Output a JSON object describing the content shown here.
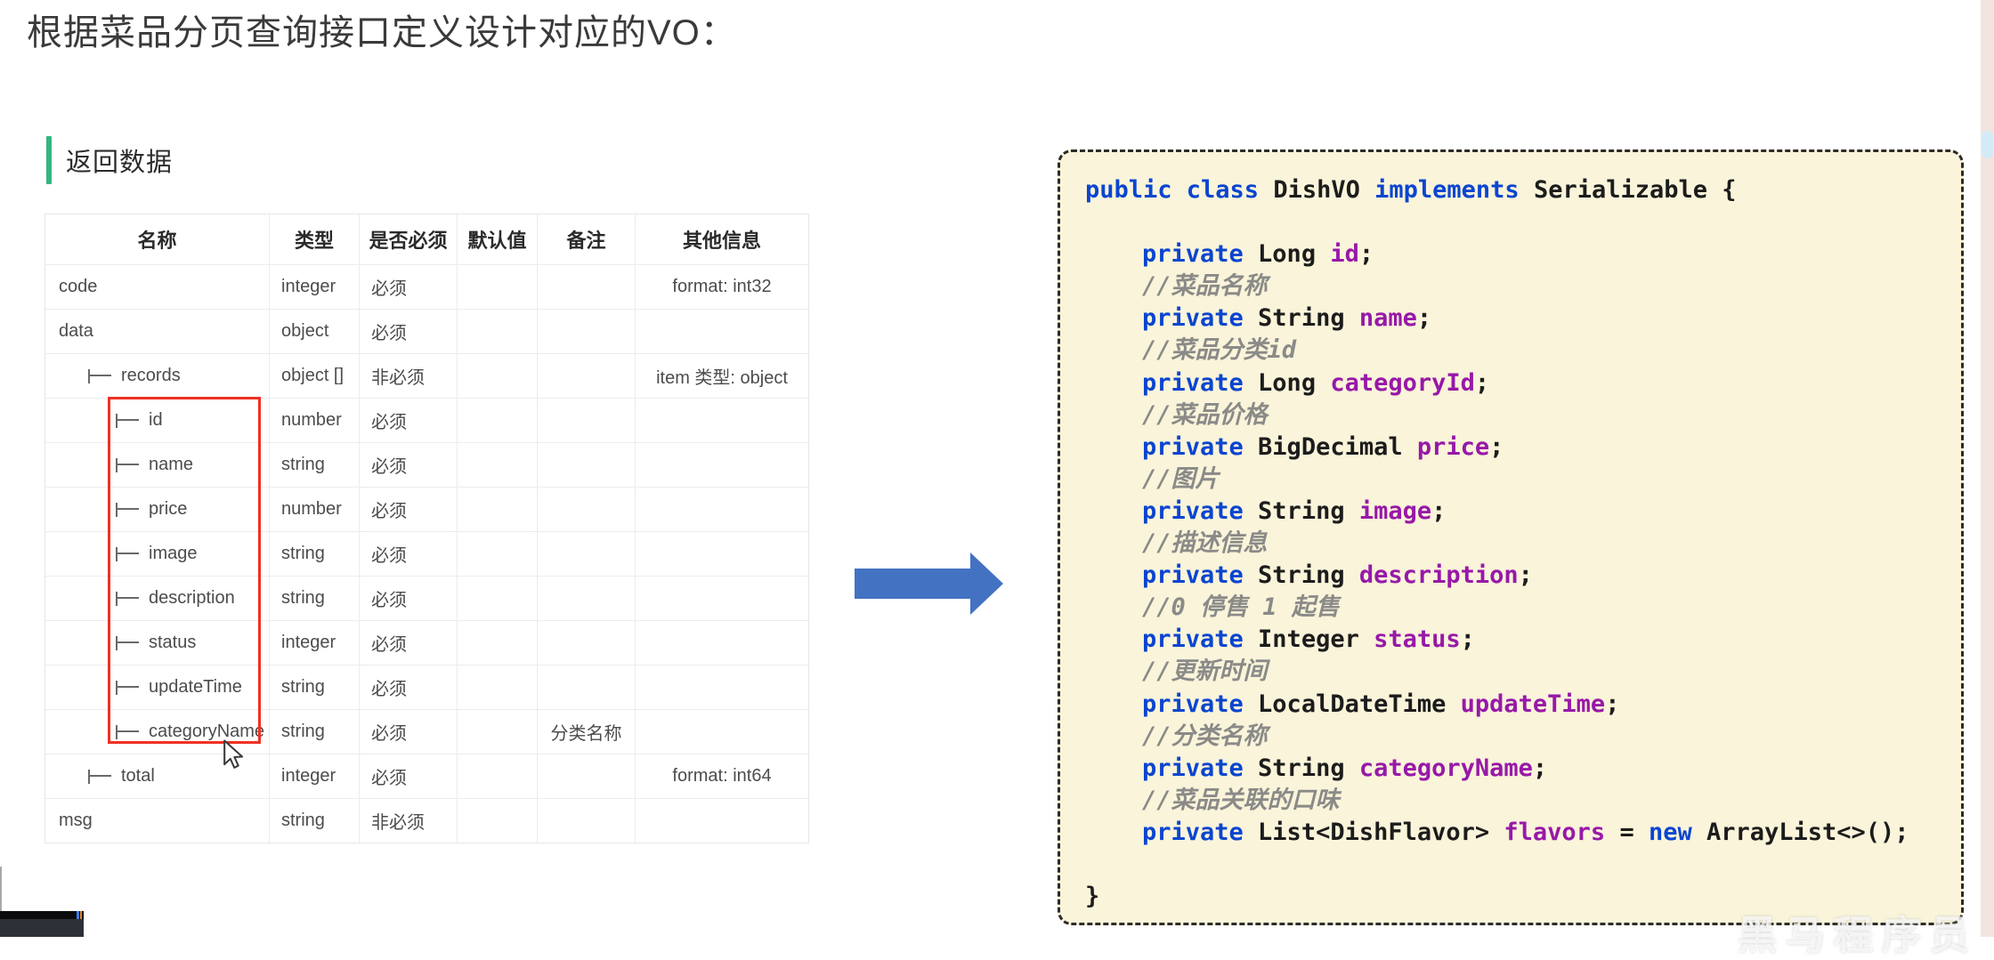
{
  "page": {
    "title": "根据菜品分页查询接口定义设计对应的VO："
  },
  "section": {
    "label": "返回数据",
    "accent_color": "#35b57f"
  },
  "table": {
    "tree_glyph": "⊢",
    "headers": [
      "名称",
      "类型",
      "是否必须",
      "默认值",
      "备注",
      "其他信息"
    ],
    "rows": [
      {
        "name": "code",
        "level": 0,
        "type": "integer",
        "required": "必须",
        "default": "",
        "note": "",
        "other": "format: int32"
      },
      {
        "name": "data",
        "level": 0,
        "type": "object",
        "required": "必须",
        "default": "",
        "note": "",
        "other": ""
      },
      {
        "name": "records",
        "level": 1,
        "type": "object []",
        "required": "非必须",
        "default": "",
        "note": "",
        "other": "item 类型: object"
      },
      {
        "name": "id",
        "level": 2,
        "type": "number",
        "required": "必须",
        "default": "",
        "note": "",
        "other": ""
      },
      {
        "name": "name",
        "level": 2,
        "type": "string",
        "required": "必须",
        "default": "",
        "note": "",
        "other": ""
      },
      {
        "name": "price",
        "level": 2,
        "type": "number",
        "required": "必须",
        "default": "",
        "note": "",
        "other": ""
      },
      {
        "name": "image",
        "level": 2,
        "type": "string",
        "required": "必须",
        "default": "",
        "note": "",
        "other": ""
      },
      {
        "name": "description",
        "level": 2,
        "type": "string",
        "required": "必须",
        "default": "",
        "note": "",
        "other": ""
      },
      {
        "name": "status",
        "level": 2,
        "type": "integer",
        "required": "必须",
        "default": "",
        "note": "",
        "other": ""
      },
      {
        "name": "updateTime",
        "level": 2,
        "type": "string",
        "required": "必须",
        "default": "",
        "note": "",
        "other": ""
      },
      {
        "name": "categoryName",
        "level": 2,
        "type": "string",
        "required": "必须",
        "default": "",
        "note": "分类名称",
        "other": ""
      },
      {
        "name": "total",
        "level": 1,
        "type": "integer",
        "required": "必须",
        "default": "",
        "note": "",
        "other": "format: int64"
      },
      {
        "name": "msg",
        "level": 0,
        "type": "string",
        "required": "非必须",
        "default": "",
        "note": "",
        "other": ""
      }
    ],
    "highlight_box_color": "#ee3124"
  },
  "arrow": {
    "color": "#4372c2"
  },
  "code_block": {
    "background": "#faf4da",
    "keyword_color": "#0b45d0",
    "field_color": "#9719a8",
    "comment_color": "#8a8a88",
    "lines": [
      {
        "indent": 0,
        "tokens": [
          [
            "public class ",
            "k"
          ],
          [
            "DishVO ",
            "p"
          ],
          [
            "implements ",
            "k"
          ],
          [
            "Serializable {",
            "p"
          ]
        ]
      },
      {
        "indent": 0,
        "tokens": []
      },
      {
        "indent": 1,
        "tokens": [
          [
            "private ",
            "k"
          ],
          [
            "Long ",
            "p"
          ],
          [
            "id",
            "f"
          ],
          [
            ";",
            "p"
          ]
        ]
      },
      {
        "indent": 1,
        "tokens": [
          [
            "//菜品名称",
            "c"
          ]
        ]
      },
      {
        "indent": 1,
        "tokens": [
          [
            "private ",
            "k"
          ],
          [
            "String ",
            "p"
          ],
          [
            "name",
            "f"
          ],
          [
            ";",
            "p"
          ]
        ]
      },
      {
        "indent": 1,
        "tokens": [
          [
            "//菜品分类id",
            "c"
          ]
        ]
      },
      {
        "indent": 1,
        "tokens": [
          [
            "private ",
            "k"
          ],
          [
            "Long ",
            "p"
          ],
          [
            "categoryId",
            "f"
          ],
          [
            ";",
            "p"
          ]
        ]
      },
      {
        "indent": 1,
        "tokens": [
          [
            "//菜品价格",
            "c"
          ]
        ]
      },
      {
        "indent": 1,
        "tokens": [
          [
            "private ",
            "k"
          ],
          [
            "BigDecimal ",
            "p"
          ],
          [
            "price",
            "f"
          ],
          [
            ";",
            "p"
          ]
        ]
      },
      {
        "indent": 1,
        "tokens": [
          [
            "//图片",
            "c"
          ]
        ]
      },
      {
        "indent": 1,
        "tokens": [
          [
            "private ",
            "k"
          ],
          [
            "String ",
            "p"
          ],
          [
            "image",
            "f"
          ],
          [
            ";",
            "p"
          ]
        ]
      },
      {
        "indent": 1,
        "tokens": [
          [
            "//描述信息",
            "c"
          ]
        ]
      },
      {
        "indent": 1,
        "tokens": [
          [
            "private ",
            "k"
          ],
          [
            "String ",
            "p"
          ],
          [
            "description",
            "f"
          ],
          [
            ";",
            "p"
          ]
        ]
      },
      {
        "indent": 1,
        "tokens": [
          [
            "//0 停售 1 起售",
            "c"
          ]
        ]
      },
      {
        "indent": 1,
        "tokens": [
          [
            "private ",
            "k"
          ],
          [
            "Integer ",
            "p"
          ],
          [
            "status",
            "f"
          ],
          [
            ";",
            "p"
          ]
        ]
      },
      {
        "indent": 1,
        "tokens": [
          [
            "//更新时间",
            "c"
          ]
        ]
      },
      {
        "indent": 1,
        "tokens": [
          [
            "private ",
            "k"
          ],
          [
            "LocalDateTime ",
            "p"
          ],
          [
            "updateTime",
            "f"
          ],
          [
            ";",
            "p"
          ]
        ]
      },
      {
        "indent": 1,
        "tokens": [
          [
            "//分类名称",
            "c"
          ]
        ]
      },
      {
        "indent": 1,
        "tokens": [
          [
            "private ",
            "k"
          ],
          [
            "String ",
            "p"
          ],
          [
            "categoryName",
            "f"
          ],
          [
            ";",
            "p"
          ]
        ]
      },
      {
        "indent": 1,
        "tokens": [
          [
            "//菜品关联的口味",
            "c"
          ]
        ]
      },
      {
        "indent": 1,
        "tokens": [
          [
            "private ",
            "k"
          ],
          [
            "List<DishFlavor> ",
            "p"
          ],
          [
            "flavors ",
            "f"
          ],
          [
            "= ",
            "p"
          ],
          [
            "new ",
            "k"
          ],
          [
            "ArrayList<>();",
            "p"
          ]
        ]
      },
      {
        "indent": 0,
        "tokens": []
      },
      {
        "indent": 0,
        "tokens": [
          [
            "}",
            "p"
          ]
        ]
      }
    ]
  },
  "watermark": {
    "text": "黑马程序员"
  }
}
